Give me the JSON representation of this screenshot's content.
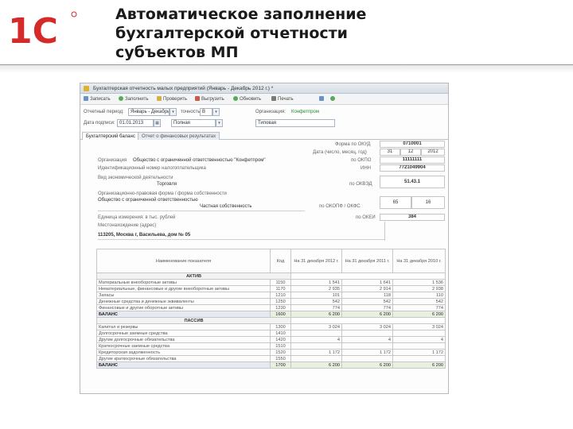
{
  "slide": {
    "logo_text": "1С",
    "title_lines": [
      "Автоматическое заполнение",
      "бухгалтерской отчетности",
      "субъектов МП"
    ]
  },
  "window": {
    "title": "Бухгалтерская отчетность малых предприятий (Январь - Декабрь 2012 г.) *",
    "toolbar": [
      "Записать",
      "Заполнить",
      "Проверить",
      "Выгрузить",
      "Обновить",
      "Печать"
    ],
    "period_label": "Отчетный период:",
    "period_value": "Январь - Декабрь 2012 г.",
    "detail_label": "точность:",
    "detail_value": "В",
    "org_label": "Организация:",
    "org_value": "Конфетпром",
    "date_label": "Дата подписи:",
    "date_value": "01.01.2013",
    "form_label": "Полная",
    "option_value": "Типовая",
    "tabs": [
      "Бухгалтерский баланс",
      "Отчет о финансовых результатах"
    ]
  },
  "document": {
    "forms_label": "Форма по ОКУД",
    "okud": "0710001",
    "date_label": "Дата (число, месяц, год)",
    "date_cells": [
      "31",
      "12",
      "2012"
    ],
    "org_row_label": "Организация",
    "org_row_value": "Общество с ограниченной ответственностью \"Конфетпром\"",
    "okpo_label": "по ОКПО",
    "okpo": "11111111",
    "inn_row_label": "Идентификационный номер налогоплательщика",
    "inn_label": "ИНН",
    "inn": "7721049904",
    "activity_label": "Вид экономической деятельности",
    "activity_value": "Торговля",
    "okved_label": "по ОКВЭД",
    "okved": "51.43.1",
    "legal_form_label": "Организационно-правовая форма / форма собственности",
    "legal_form_value": "Общество с ограниченной ответственностью",
    "ownership_value": "Частная собственность",
    "okopf_label": "по ОКОПФ / ОКФС",
    "okopf": "65",
    "okfs": "16",
    "unit_label": "Единица измерения: в тыс. рублей",
    "okei_label": "по ОКЕИ",
    "okei": "384",
    "address_label": "Местонахождение (адрес)",
    "address_value": "113205, Москва г, Васильева, дом № 05"
  },
  "balance": {
    "headers": [
      "Наименование показателя",
      "Код",
      "На 31 декабря 2012 г.",
      "На 31 декабря 2011 г.",
      "На 31 декабря 2010 г."
    ],
    "sections": [
      {
        "title": "АКТИВ",
        "rows": [
          {
            "name": "Материальные внеоборотные активы",
            "code": "1150",
            "v1": "1 541",
            "v2": "1 641",
            "v3": "1 536"
          },
          {
            "name": "Нематериальные, финансовые и другие внеоборотные активы",
            "code": "1170",
            "v1": "2 935",
            "v2": "2 914",
            "v3": "2 938"
          },
          {
            "name": "Запасы",
            "code": "1210",
            "v1": "101",
            "v2": "118",
            "v3": "110"
          },
          {
            "name": "Денежные средства и денежные эквиваленты",
            "code": "1250",
            "v1": "542",
            "v2": "542",
            "v3": "542"
          },
          {
            "name": "Финансовые и другие оборотные активы",
            "code": "1230",
            "v1": "774",
            "v2": "774",
            "v3": "774"
          }
        ],
        "total": {
          "name": "БАЛАНС",
          "code": "1600",
          "v1": "6 200",
          "v2": "6 200",
          "v3": "6 200"
        }
      },
      {
        "title": "ПАССИВ",
        "rows": [
          {
            "name": "Капитал и резервы",
            "code": "1300",
            "v1": "3 024",
            "v2": "3 024",
            "v3": "3 024"
          },
          {
            "name": "Долгосрочные заемные средства",
            "code": "1410",
            "v1": "",
            "v2": "",
            "v3": ""
          },
          {
            "name": "Другие долгосрочные обязательства",
            "code": "1420",
            "v1": "4",
            "v2": "4",
            "v3": "4"
          },
          {
            "name": "Краткосрочные заемные средства",
            "code": "1510",
            "v1": "",
            "v2": "",
            "v3": ""
          },
          {
            "name": "Кредиторская задолженность",
            "code": "1520",
            "v1": "1 172",
            "v2": "1 172",
            "v3": "1 172"
          },
          {
            "name": "Другие краткосрочные обязательства",
            "code": "1550",
            "v1": "",
            "v2": "",
            "v3": ""
          }
        ],
        "total": {
          "name": "БАЛАНС",
          "code": "1700",
          "v1": "6 200",
          "v2": "6 200",
          "v3": "6 200"
        }
      }
    ]
  }
}
